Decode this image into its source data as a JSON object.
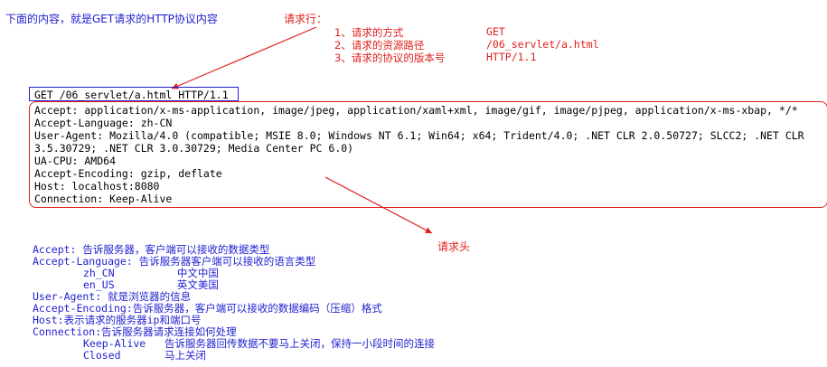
{
  "top_note": "下面的内容，就是GET请求的HTTP协议内容",
  "request_line_title": "请求行：",
  "request_line_items": [
    {
      "label": "1、请求的方式",
      "value": "GET"
    },
    {
      "label": "2、请求的资源路径",
      "value": "/06_servlet/a.html"
    },
    {
      "label": "3、请求的协议的版本号",
      "value": "HTTP/1.1"
    }
  ],
  "request_line": "GET /06_servlet/a.html HTTP/1.1",
  "headers": [
    "Accept: application/x-ms-application, image/jpeg, application/xaml+xml, image/gif, image/pjpeg, application/x-ms-xbap, */*",
    "Accept-Language: zh-CN",
    "User-Agent: Mozilla/4.0 (compatible; MSIE 8.0; Windows NT 6.1; Win64; x64; Trident/4.0; .NET CLR 2.0.50727; SLCC2; .NET CLR",
    "3.5.30729; .NET CLR 3.0.30729; Media Center PC 6.0)",
    "UA-CPU: AMD64",
    "Accept-Encoding: gzip, deflate",
    "Host: localhost:8080",
    "Connection: Keep-Alive"
  ],
  "request_header_label": "请求头",
  "explanations": [
    {
      "text": "Accept: 告诉服务器，客户端可以接收的数据类型",
      "indent": 0
    },
    {
      "text": "Accept-Language: 告诉服务器客户端可以接收的语言类型",
      "indent": 0
    },
    {
      "text": "zh_CN          中文中国",
      "indent": 1
    },
    {
      "text": "en_US          英文美国",
      "indent": 1
    },
    {
      "text": "User-Agent: 就是浏览器的信息",
      "indent": 0
    },
    {
      "text": "Accept-Encoding:告诉服务器，客户端可以接收的数据编码（压缩）格式",
      "indent": 0
    },
    {
      "text": "Host:表示请求的服务器ip和端口号",
      "indent": 0
    },
    {
      "text": "Connection:告诉服务器请求连接如何处理",
      "indent": 0
    },
    {
      "text": "Keep-Alive   告诉服务器回传数据不要马上关闭，保持一小段时间的连接",
      "indent": 1
    },
    {
      "text": "Closed       马上关闭",
      "indent": 1
    }
  ],
  "colors": {
    "blue": "#1f1fd0",
    "red": "#e0201c"
  }
}
